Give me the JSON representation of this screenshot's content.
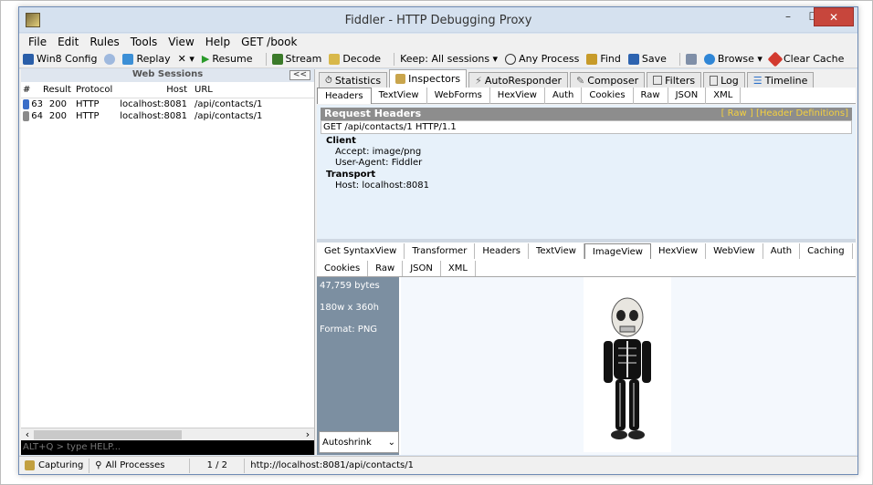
{
  "window": {
    "title": "Fiddler - HTTP Debugging Proxy",
    "min": "–",
    "max": "☐",
    "close": "✕"
  },
  "menu": [
    "File",
    "Edit",
    "Rules",
    "Tools",
    "View",
    "Help",
    "GET /book"
  ],
  "toolbar": {
    "items": [
      "Win8 Config",
      "Replay",
      "✕ ▾",
      "Resume",
      "Stream",
      "Decode",
      "Keep: All sessions ▾",
      "Any Process",
      "Find",
      "Save",
      "Browse ▾",
      "Clear Cache"
    ]
  },
  "sessions": {
    "title": "Web Sessions",
    "collapse": "<<",
    "headers": [
      "#",
      "Result",
      "Protocol",
      "Host",
      "URL"
    ],
    "rows": [
      {
        "id": "63",
        "result": "200",
        "protocol": "HTTP",
        "host": "localhost:8081",
        "url": "/api/contacts/1"
      },
      {
        "id": "64",
        "result": "200",
        "protocol": "HTTP",
        "host": "localhost:8081",
        "url": "/api/contacts/1"
      }
    ],
    "quickexec": "ALT+Q > type HELP..."
  },
  "tabs": [
    "Statistics",
    "Inspectors",
    "AutoResponder",
    "Composer",
    "Filters",
    "Log",
    "Timeline"
  ],
  "request": {
    "subtabs": [
      "Headers",
      "TextView",
      "WebForms",
      "HexView",
      "Auth",
      "Cookies",
      "Raw",
      "JSON",
      "XML"
    ],
    "bar": "Request Headers",
    "links": "[ Raw ]   [Header Definitions]",
    "line": "GET /api/contacts/1 HTTP/1.1",
    "groups": [
      {
        "name": "Client",
        "headers": [
          "Accept: image/png",
          "User-Agent: Fiddler"
        ]
      },
      {
        "name": "Transport",
        "headers": [
          "Host: localhost:8081"
        ]
      }
    ]
  },
  "response": {
    "tabs_row1": [
      "Get SyntaxView",
      "Transformer",
      "Headers",
      "TextView",
      "ImageView",
      "HexView",
      "WebView",
      "Auth",
      "Caching"
    ],
    "tabs_row2": [
      "Cookies",
      "Raw",
      "JSON",
      "XML"
    ],
    "info": [
      "47,759 bytes",
      "180w x 360h",
      "Format: PNG"
    ],
    "autoshrink": "Autoshrink"
  },
  "status": {
    "capturing": "Capturing",
    "processes": "All Processes",
    "count": "1 / 2",
    "url": "http://localhost:8081/api/contacts/1"
  }
}
